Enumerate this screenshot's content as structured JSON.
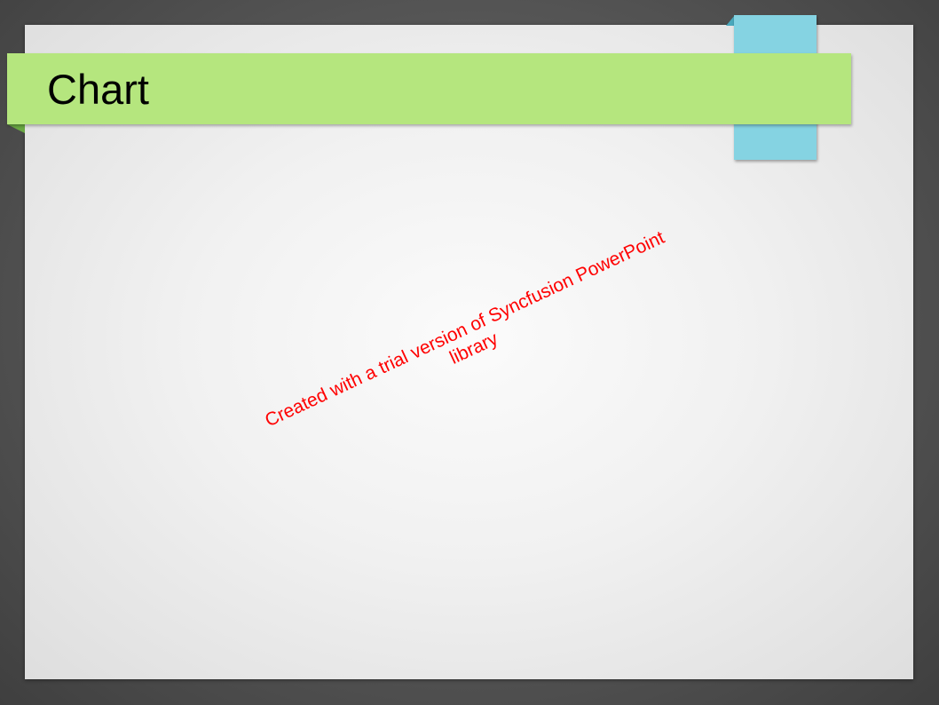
{
  "slide": {
    "title": "Chart"
  },
  "watermark": {
    "line1": "Created with a trial version of Syncfusion PowerPoint",
    "line2": "library",
    "color": "#ff0000"
  },
  "colors": {
    "title_bar": "#b5e67e",
    "accent_tab": "#85d3e2",
    "background": "#555555"
  }
}
